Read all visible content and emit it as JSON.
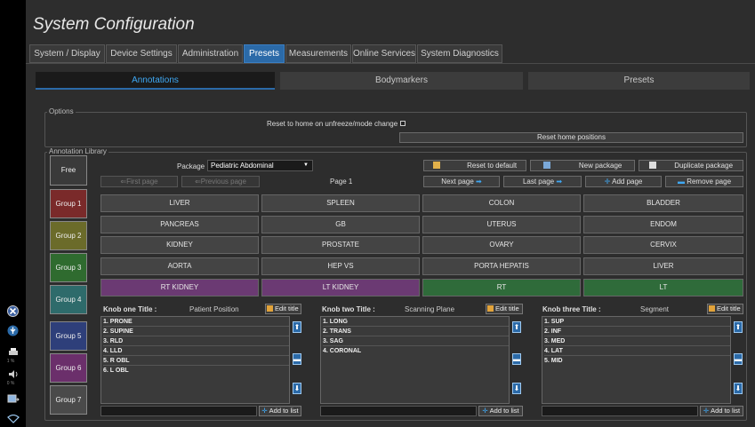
{
  "window": {
    "title": "System Configuration"
  },
  "tabs": [
    {
      "label": "System / Display",
      "active": false
    },
    {
      "label": "Device Settings",
      "active": false
    },
    {
      "label": "Administration",
      "active": false
    },
    {
      "label": "Presets",
      "active": true
    },
    {
      "label": "Measurements",
      "active": false
    },
    {
      "label": "Online Services",
      "active": false
    },
    {
      "label": "System Diagnostics",
      "active": false
    }
  ],
  "subtabs": [
    {
      "label": "Annotations",
      "active": true
    },
    {
      "label": "Bodymarkers",
      "active": false
    },
    {
      "label": "Presets",
      "active": false
    }
  ],
  "options": {
    "group_label": "Options",
    "reset_home_label": "Reset to home on unfreeze/mode change",
    "reset_home_checked": false,
    "reset_positions_button": "Reset home positions"
  },
  "library": {
    "group_label": "Annotation Library",
    "free_annot_button": "Free Annot.",
    "package_label": "Package",
    "package_value": "Pediatric Abdominal",
    "reset_default_button": "Reset to default",
    "new_package_button": "New package",
    "duplicate_package_button": "Duplicate package",
    "first_page_button": "First page",
    "previous_page_button": "Previous page",
    "page_indicator": "Page 1",
    "next_page_button": "Next page",
    "last_page_button": "Last page",
    "add_page_button": "Add page",
    "remove_page_button": "Remove page",
    "groups": [
      "Group 1",
      "Group 2",
      "Group 3",
      "Group 4",
      "Group 5",
      "Group 6",
      "Group 7"
    ],
    "group_colors": [
      "#7a2a2a",
      "#6b6b2a",
      "#2f6b2f",
      "#2e6b6b",
      "#2e3f7a",
      "#6b2f6b",
      "#4a4a4a"
    ],
    "annotation_grid": [
      [
        "LIVER",
        "SPLEEN",
        "COLON",
        "BLADDER"
      ],
      [
        "PANCREAS",
        "GB",
        "UTERUS",
        "ENDOM"
      ],
      [
        "KIDNEY",
        "PROSTATE",
        "OVARY",
        "CERVIX"
      ],
      [
        "AORTA",
        "HEP VS",
        "PORTA HEPATIS",
        "LIVER"
      ],
      [
        "RT KIDNEY",
        "LT KIDNEY",
        "RT",
        "LT"
      ]
    ]
  },
  "knobs": [
    {
      "title_label": "Knob one Title :",
      "title_value": "Patient Position",
      "edit_button": "Edit title",
      "items": [
        "1. PRONE",
        "2. SUPINE",
        "3. RLD",
        "4. LLD",
        "5. R OBL",
        "6. L OBL"
      ],
      "add_button": "Add to list"
    },
    {
      "title_label": "Knob two Title :",
      "title_value": "Scanning Plane",
      "edit_button": "Edit title",
      "items": [
        "1. LONG",
        "2. TRANS",
        "3. SAG",
        "4. CORONAL"
      ],
      "add_button": "Add to list"
    },
    {
      "title_label": "Knob three Title :",
      "title_value": "Segment",
      "edit_button": "Edit title",
      "items": [
        "1. SUP",
        "2. INF",
        "3. MED",
        "4. LAT",
        "5. MID"
      ],
      "add_button": "Add to list"
    }
  ],
  "left_bar": {
    "values": [
      "1 %",
      "0 %"
    ]
  },
  "icons": {
    "close": "close-circle-icon",
    "usb": "usb-icon",
    "printer": "printer-icon",
    "speaker": "speaker-icon",
    "image_export": "image-export-icon",
    "wifi": "wifi-icon"
  }
}
